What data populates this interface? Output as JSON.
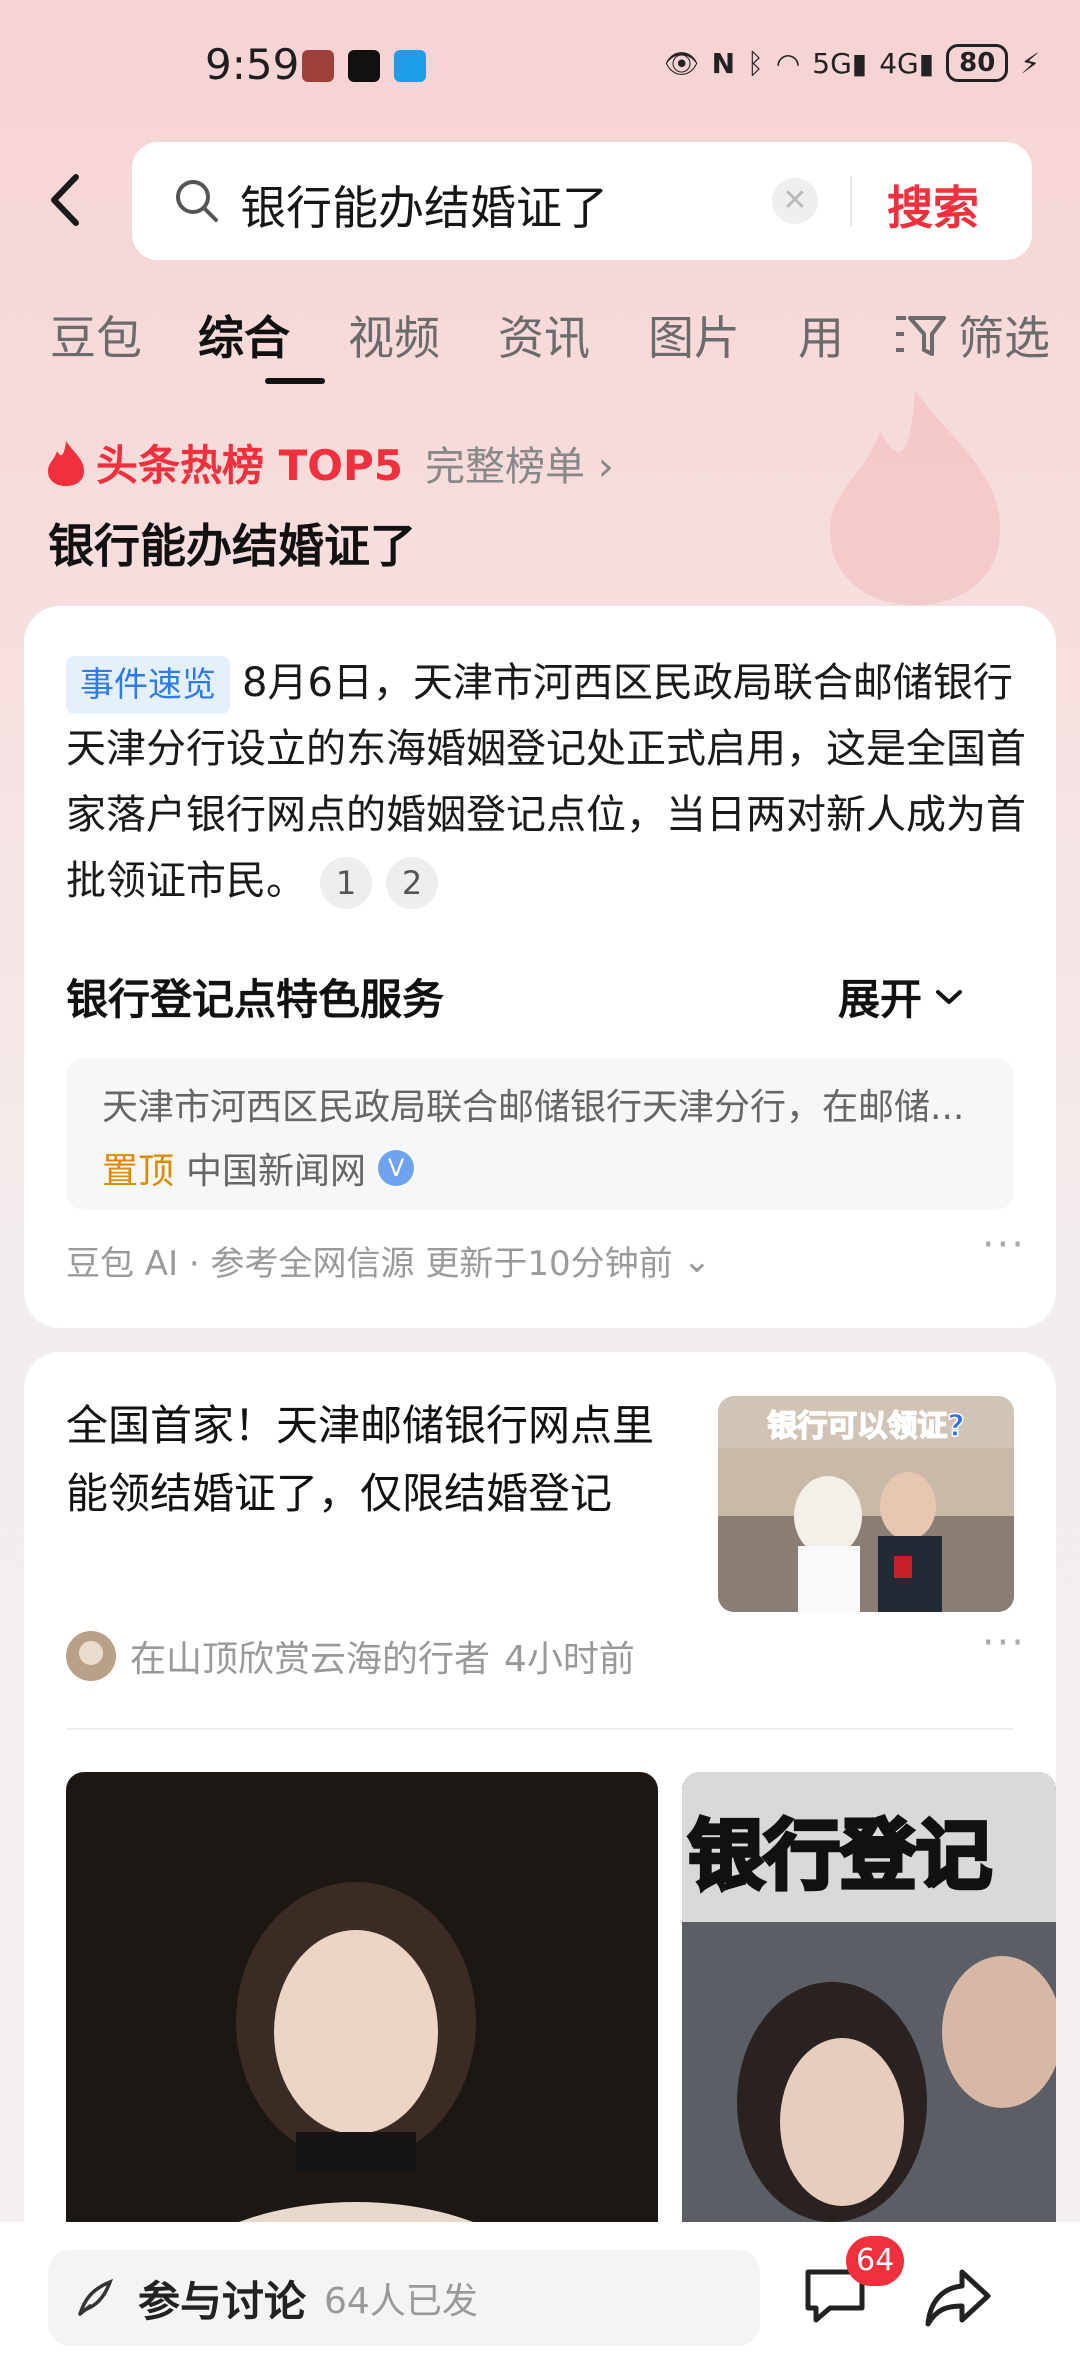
{
  "status_bar": {
    "time": "9:59",
    "battery": "80",
    "signal1": "5G",
    "signal2": "4G"
  },
  "search": {
    "query": "银行能办结婚证了",
    "button": "搜索"
  },
  "tabs": [
    "豆包",
    "综合",
    "视频",
    "资讯",
    "图片",
    "用"
  ],
  "active_tab": "综合",
  "filter_label": "筛选",
  "hot": {
    "title": "头条热榜 TOP5",
    "link": "完整榜单",
    "query_title": "银行能办结婚证了"
  },
  "ai_card": {
    "tag": "事件速览",
    "summary": "8月6日，天津市河西区民政局联合邮储银行天津分行设立的东海婚姻登记处正式启用，这是全国首家落户银行网点的婚姻登记点位，当日两对新人成为首批领证市民。",
    "citations": [
      "1",
      "2"
    ],
    "section_title": "银行登记点特色服务",
    "expand_label": "展开",
    "section_snippet": "天津市河西区民政局联合邮储银行天津分行，在邮储...",
    "pinned_label": "置顶",
    "source": "中国新闻网",
    "footer": "豆包 AI · 参考全网信源 更新于10分钟前"
  },
  "news": {
    "title": "全国首家！天津邮储银行网点里能领结婚证了，仅限结婚登记",
    "thumb_caption": "银行可以领证?",
    "author": "在山顶欣赏云海的行者",
    "time": "4小时前",
    "video2_caption": "银行登记"
  },
  "bottom_bar": {
    "discuss_label": "参与讨论",
    "discuss_count": "64人已发",
    "comment_badge": "64"
  },
  "colors": {
    "accent_red": "#f0303c",
    "tag_blue": "#2f7be8",
    "pin_orange": "#e08a00"
  }
}
